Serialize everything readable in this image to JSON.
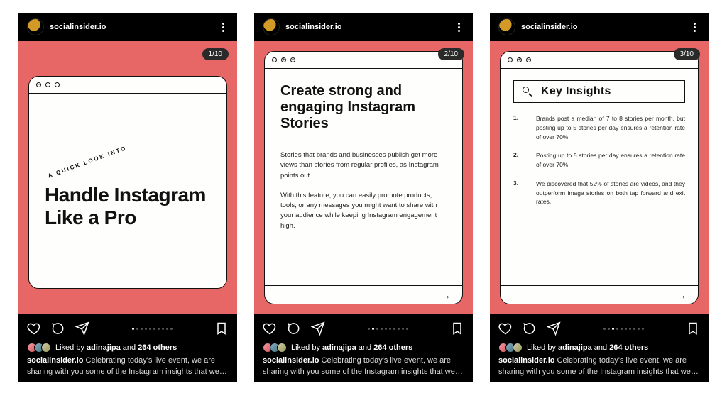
{
  "header": {
    "handle": "socialinsider.io"
  },
  "slides": [
    {
      "badge": "1/10",
      "eyebrow": "A QUICK LOOK INTO",
      "title": "Handle Instagram Like a Pro"
    },
    {
      "badge": "2/10",
      "title": "Create strong and engaging Instagram Stories",
      "p1": "Stories that brands and businesses publish get more views than stories from regular profiles, as Instagram points out.",
      "p2": "With this feature, you can easily promote products, tools, or any messages you might want to share with your audience while keeping Instagram engagement high."
    },
    {
      "badge": "3/10",
      "title": "Key Insights",
      "insights": [
        {
          "n": "1.",
          "t": "Brands post a median of 7 to 8 stories per month, but posting up to 5 stories per day ensures a retention rate of over 70%."
        },
        {
          "n": "2.",
          "t": "Posting up to 5 stories per day ensures a retention rate of over 70%."
        },
        {
          "n": "3.",
          "t": "We discovered that 52% of stories are videos, and they outperform image stories on both tap forward and exit rates."
        }
      ]
    }
  ],
  "likes": {
    "liked_by_name": "adinajipa",
    "liked_by_count": "264 others",
    "prefix": "Liked by ",
    "and": " and "
  },
  "caption": {
    "author": "socialinsider.io",
    "text": " Celebrating today's live event, we are sharing with you some of the Instagram insights that we put together in o",
    "more": "… more"
  }
}
